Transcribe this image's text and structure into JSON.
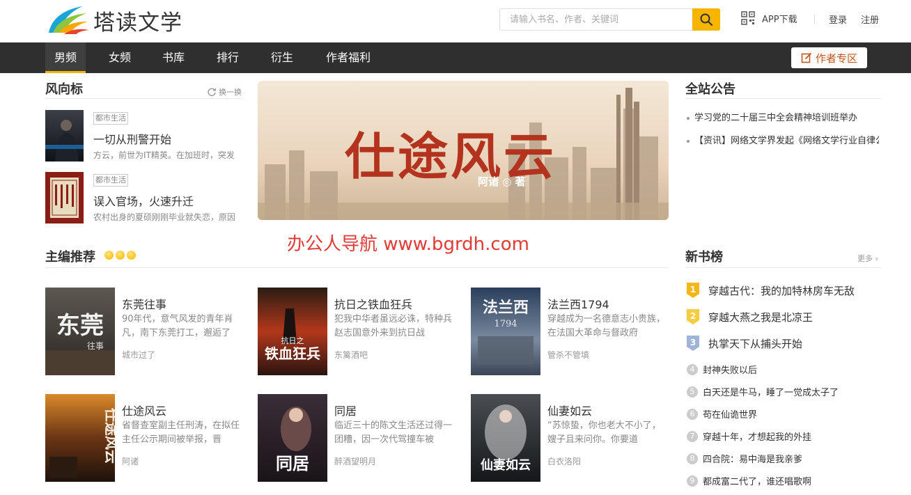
{
  "header": {
    "logo_text": "塔读文学",
    "search_placeholder": "请输入书名、作者、关键词",
    "app_download": "APP下载",
    "login": "登录",
    "register": "注册"
  },
  "nav": {
    "items": [
      "男频",
      "女频",
      "书库",
      "排行",
      "衍生",
      "作者福利"
    ],
    "author_zone": "作者专区"
  },
  "weathervane": {
    "title": "风向标",
    "refresh": "换一换",
    "books": [
      {
        "tag": "都市生活",
        "title": "一切从刑警开始",
        "desc": "方云，前世为IT精英。在加班时，突发"
      },
      {
        "tag": "都市生活",
        "title": "误入官场，火速升迁",
        "desc": "农村出身的夏硕刚刚毕业就失恋，原因"
      }
    ]
  },
  "banner": {
    "title": "仕途风云",
    "byline": "阿诸 ◎ 著"
  },
  "watermark": "办公人导航  www.bgrdh.com",
  "notices": {
    "title": "全站公告",
    "items": [
      "学习党的二十届三中全会精神培训班举办",
      "【资讯】网络文学界发起《网络文学行业自律公约》"
    ]
  },
  "editor_picks": {
    "title": "主编推荐",
    "books": [
      {
        "title": "东莞往事",
        "desc": "90年代，意气风发的青年肖凡，南下东莞打工，邂逅了",
        "author": "城市过了",
        "cover_text": "东莞",
        "cover_sub": "往事"
      },
      {
        "title": "抗日之铁血狂兵",
        "desc": "犯我中华者虽远必诛，特种兵赵志国意外来到抗日战",
        "author": "东篱酒吧",
        "cover_text": "铁血狂兵",
        "cover_sub": "抗日之"
      },
      {
        "title": "法兰西1794",
        "desc": "穿越成为一名德意志小贵族，在法国大革命与督政府",
        "author": "管杀不管填",
        "cover_text": "法兰西",
        "cover_sub": "1794"
      },
      {
        "title": "仕途风云",
        "desc": "省督查室副主任刑涛，在拟任主任公示期间被举报，晋",
        "author": "阿诸",
        "cover_text": "仕途风云",
        "cover_sub": ""
      },
      {
        "title": "同居",
        "desc": "临近三十的陈文生活还过得一团糟，因一次代驾撞车被",
        "author": "醉酒望明月",
        "cover_text": "同居",
        "cover_sub": ""
      },
      {
        "title": "仙妻如云",
        "desc": "“苏惊蛰，你也老大不小了，嫂子且来问你。你要道",
        "author": "白衣洛阳",
        "cover_text": "仙妻如云",
        "cover_sub": ""
      }
    ]
  },
  "new_rank": {
    "title": "新书榜",
    "more": "更多",
    "items": [
      "穿越古代：我的加特林房车无敌",
      "穿越大燕之我是北凉王",
      "执掌天下从捕头开始",
      "封神失败以后",
      "白天还是牛马，睡了一觉成太子了",
      "苟在仙诡世界",
      "穿越十年，才想起我的外挂",
      "四合院：易中海是我亲爹",
      "都成富二代了，谁还唱歌啊"
    ],
    "numbers": [
      "1",
      "2",
      "3",
      "4",
      "5",
      "6",
      "7",
      "8",
      "9"
    ]
  },
  "colors": {
    "accent": "#f7b500",
    "nav_bg": "#2f2f2f",
    "author_zone_text": "#c1551b",
    "watermark": "#e23a34"
  }
}
